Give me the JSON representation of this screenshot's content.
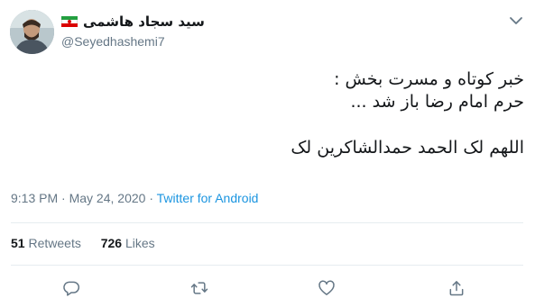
{
  "user": {
    "display_name": "سید سجاد هاشمی",
    "handle": "@Seyedhashemi7",
    "flag_icon": "iran-flag-icon"
  },
  "tweet": {
    "lines": [
      "خبر کوتاه و مسرت بخش :",
      "حرم امام رضا باز شد ...",
      "اللهم لک الحمد حمدالشاکرین لک"
    ]
  },
  "meta": {
    "time": "9:13 PM",
    "sep1": " · ",
    "date": "May 24, 2020",
    "sep2": " · ",
    "source": "Twitter for Android"
  },
  "stats": {
    "retweets_count": "51",
    "retweets_label": "Retweets",
    "likes_count": "726",
    "likes_label": "Likes"
  },
  "actions": [
    "reply-icon",
    "retweet-icon",
    "like-icon",
    "share-icon"
  ],
  "colors": {
    "link": "#1b95e0",
    "muted": "#657786",
    "text": "#14171a",
    "divider": "#e6ecf0"
  }
}
